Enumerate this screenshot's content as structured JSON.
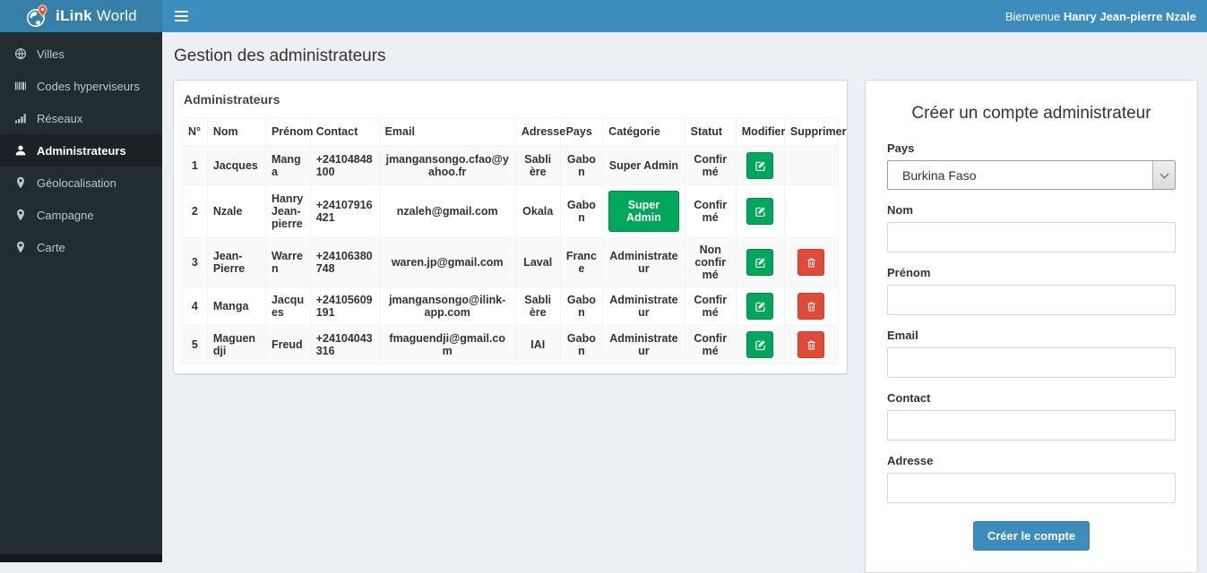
{
  "colors": {
    "navbar": "#3c8dbc",
    "logo_bg": "#367fa9",
    "sidebar_bg": "#222d32",
    "sidebar_active_bg": "#1a2226",
    "page_bg": "#ecf0f5",
    "success_green": "#00a65a",
    "danger_red": "#dd4b39",
    "primary_blue": "#3c8dbc",
    "pin_orange": "#f4511e"
  },
  "header": {
    "brand_bold": "iLink",
    "brand_rest": " World",
    "welcome_prefix": "Bienvenue ",
    "welcome_name": "Hanry Jean-pierre Nzale"
  },
  "page": {
    "title": "Gestion des administrateurs"
  },
  "sidebar": {
    "items": [
      {
        "name": "villes",
        "label": "Villes",
        "icon": "globe-icon",
        "active": false
      },
      {
        "name": "codes-hyperviseurs",
        "label": "Codes hyperviseurs",
        "icon": "barcode-icon",
        "active": false
      },
      {
        "name": "reseaux",
        "label": "Réseaux",
        "icon": "signal-bars-icon",
        "active": false
      },
      {
        "name": "administrateurs",
        "label": "Administrateurs",
        "icon": "user-icon",
        "active": true
      },
      {
        "name": "geolocalisation",
        "label": "Géolocalisation",
        "icon": "map-marker-icon",
        "active": false
      },
      {
        "name": "campagne",
        "label": "Campagne",
        "icon": "map-marker-icon",
        "active": false
      },
      {
        "name": "carte",
        "label": "Carte",
        "icon": "map-marker-icon",
        "active": false
      }
    ]
  },
  "table_panel": {
    "title": "Administrateurs",
    "columns": [
      "N°",
      "Nom",
      "Prénom",
      "Contact",
      "Email",
      "Adresse",
      "Pays",
      "Catégorie",
      "Statut",
      "Modifier",
      "Supprimer"
    ],
    "edit_icon": "edit-icon",
    "delete_icon": "trash-icon",
    "rows": [
      {
        "n": "1",
        "nom": "Jacques",
        "prenom": "Manga",
        "contact": "+24104848100",
        "email": "jmangansongo.cfao@yahoo.fr",
        "adresse": "Sablière",
        "pays": "Gabon",
        "categorie": "Super Admin",
        "categorie_as_button": false,
        "statut": "Confirmé",
        "can_delete": false
      },
      {
        "n": "2",
        "nom": "Nzale",
        "prenom": "Hanry Jean-pierre",
        "contact": "+24107916421",
        "email": "nzaleh@gmail.com",
        "adresse": "Okala",
        "pays": "Gabon",
        "categorie": "Super Admin",
        "categorie_as_button": true,
        "statut": "Confirmé",
        "can_delete": false
      },
      {
        "n": "3",
        "nom": "Jean-Pierre",
        "prenom": "Warren",
        "contact": "+24106380748",
        "email": "waren.jp@gmail.com",
        "adresse": "Laval",
        "pays": "France",
        "categorie": "Administrateur",
        "categorie_as_button": false,
        "statut": "Non confirmé",
        "can_delete": true
      },
      {
        "n": "4",
        "nom": "Manga",
        "prenom": "Jacques",
        "contact": "+24105609191",
        "email": "jmangansongo@ilink-app.com",
        "adresse": "Sablière",
        "pays": "Gabon",
        "categorie": "Administrateur",
        "categorie_as_button": false,
        "statut": "Confirmé",
        "can_delete": true
      },
      {
        "n": "5",
        "nom": "Maguendji",
        "prenom": "Freud",
        "contact": "+24104043316",
        "email": "fmaguendji@gmail.com",
        "adresse": "IAI",
        "pays": "Gabon",
        "categorie": "Administrateur",
        "categorie_as_button": false,
        "statut": "Confirmé",
        "can_delete": true
      }
    ]
  },
  "form_panel": {
    "title": "Créer un compte administrateur",
    "fields": [
      {
        "name": "pays",
        "label": "Pays",
        "type": "select",
        "value": "Burkina Faso"
      },
      {
        "name": "nom",
        "label": "Nom",
        "type": "text",
        "value": ""
      },
      {
        "name": "prenom",
        "label": "Prénom",
        "type": "text",
        "value": ""
      },
      {
        "name": "email",
        "label": "Email",
        "type": "text",
        "value": ""
      },
      {
        "name": "contact",
        "label": "Contact",
        "type": "text",
        "value": ""
      },
      {
        "name": "adresse",
        "label": "Adresse",
        "type": "text",
        "value": ""
      }
    ],
    "submit_label": "Créer le compte"
  }
}
